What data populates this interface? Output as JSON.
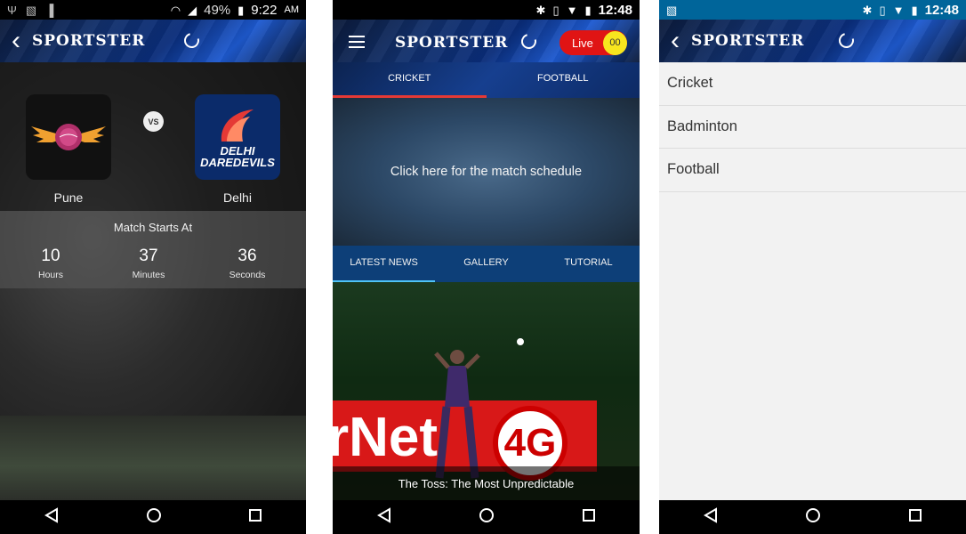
{
  "phone1": {
    "status": {
      "battery": "49%",
      "time": "9:22",
      "ampm": "AM"
    },
    "header": {
      "logo": "SPORTSTER"
    },
    "match": {
      "home_team": "Pune",
      "away_team": "Delhi",
      "away_logo_line1": "DELHI",
      "away_logo_line2": "DAREDEVILS",
      "vs": "VS"
    },
    "countdown": {
      "title": "Match Starts At",
      "hours": "10",
      "hours_label": "Hours",
      "minutes": "37",
      "minutes_label": "Minutes",
      "seconds": "36",
      "seconds_label": "Seconds"
    }
  },
  "phone2": {
    "status": {
      "time": "12:48"
    },
    "header": {
      "logo": "SPORTSTER",
      "live_label": "Live",
      "live_count": "00"
    },
    "sport_tabs": [
      "CRICKET",
      "FOOTBALL"
    ],
    "schedule_text": "Click here for the match schedule",
    "news_tabs": [
      "LATEST NEWS",
      "GALLERY",
      "TUTORIAL"
    ],
    "news": {
      "banner_text": "rNet",
      "banner_badge": "4G",
      "caption": "The Toss: The Most Unpredictable"
    }
  },
  "phone3": {
    "status": {
      "time": "12:48"
    },
    "header": {
      "logo": "SPORTSTER"
    },
    "sports": [
      "Cricket",
      "Badminton",
      "Football"
    ]
  },
  "colors": {
    "accent_red": "#e01414",
    "live_badge": "#f7e51e",
    "news_tabbar": "#0d3f78",
    "status_blue": "#00659a"
  }
}
